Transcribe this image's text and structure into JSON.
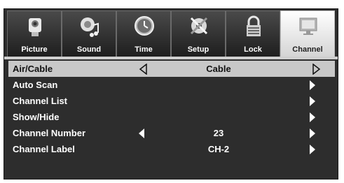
{
  "tabs": [
    {
      "label": "Picture",
      "icon": "camera-icon"
    },
    {
      "label": "Sound",
      "icon": "speaker-music-icon"
    },
    {
      "label": "Time",
      "icon": "clock-icon"
    },
    {
      "label": "Setup",
      "icon": "gear-tools-icon"
    },
    {
      "label": "Lock",
      "icon": "padlock-icon"
    },
    {
      "label": "Channel",
      "icon": "monitor-icon"
    }
  ],
  "active_tab": "Channel",
  "menu": [
    {
      "label": "Air/Cable",
      "value": "Cable"
    },
    {
      "label": "Auto Scan",
      "value": ""
    },
    {
      "label": "Channel List",
      "value": ""
    },
    {
      "label": "Show/Hide",
      "value": ""
    },
    {
      "label": "Channel Number",
      "value": "23"
    },
    {
      "label": "Channel Label",
      "value": "CH-2"
    }
  ],
  "colors": {
    "selected_row": "#c8c8c8",
    "background": "#2d2d2d"
  }
}
